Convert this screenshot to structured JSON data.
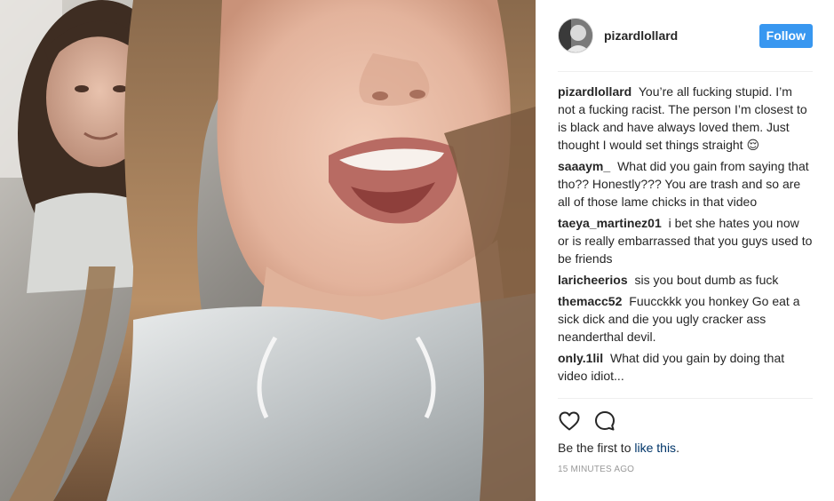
{
  "post": {
    "username": "pizardlollard",
    "follow_label": "Follow",
    "accent_color": "#3897f0"
  },
  "comments": [
    {
      "author": "pizardlollard",
      "text": "You’re all fucking stupid. I’m not a fucking racist. The person I’m closest to is black and have always loved them. Just thought I would set things straight 😌"
    },
    {
      "author": "saaaym_",
      "text": "What did you gain from saying that tho?? Honestly??? You are trash and so are all of those lame chicks in that video"
    },
    {
      "author": "taeya_martinez01",
      "text": "i bet she hates you now or is really embarrassed that you guys used to be friends"
    },
    {
      "author": "laricheerios",
      "text": "sis you bout dumb as fuck"
    },
    {
      "author": "themacc52",
      "text": "Fuucckkk you honkey Go eat a sick dick and die you ugly cracker ass neanderthal devil."
    },
    {
      "author": "only.1lil",
      "text": "What did you gain by doing that video idiot..."
    }
  ],
  "actions": {
    "like_icon": "heart-icon",
    "comment_icon": "comment-bubble-icon"
  },
  "likes": {
    "prefix": "Be the first to ",
    "link": "like this",
    "suffix": "."
  },
  "timestamp": "15 MINUTES AGO"
}
